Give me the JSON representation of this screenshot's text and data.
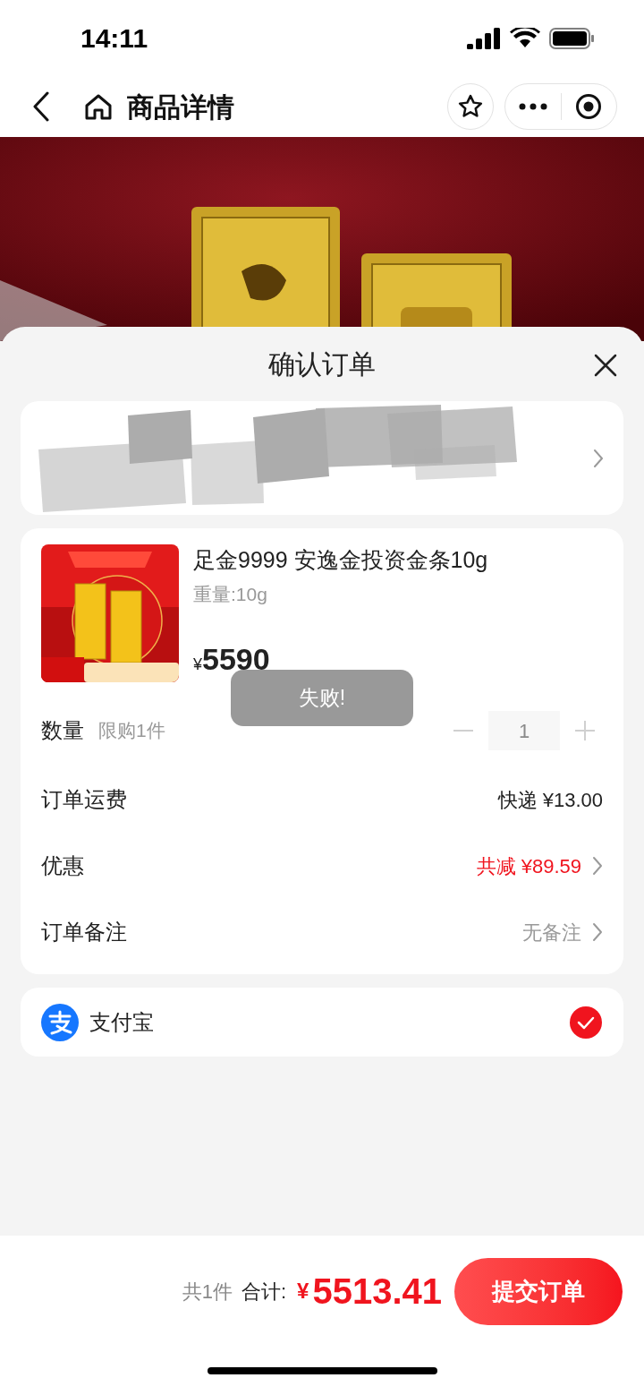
{
  "status_bar": {
    "time": "14:11"
  },
  "nav_bar": {
    "title": "商品详情"
  },
  "sheet": {
    "title": "确认订单"
  },
  "product": {
    "title": "足金9999 安逸金投资金条10g",
    "spec": "重量:10g",
    "currency": "¥",
    "price": "5590"
  },
  "quantity": {
    "label": "数量",
    "limit": "限购1件",
    "value": "1",
    "disabled": true
  },
  "rows": [
    {
      "label": "订单运费",
      "value": "快递 ¥13.00",
      "kind": "plain",
      "chevron": false
    },
    {
      "label": "优惠",
      "value": "共减 ¥89.59",
      "kind": "discount",
      "chevron": true
    },
    {
      "label": "订单备注",
      "value": "无备注",
      "kind": "muted",
      "chevron": true
    }
  ],
  "payment": {
    "label": "支付宝",
    "checked": true
  },
  "toast": {
    "text": "失败!"
  },
  "footer": {
    "count": "共1件",
    "total_label": "合计:",
    "currency": "¥",
    "total": "5513.41",
    "submit": "提交订单"
  }
}
